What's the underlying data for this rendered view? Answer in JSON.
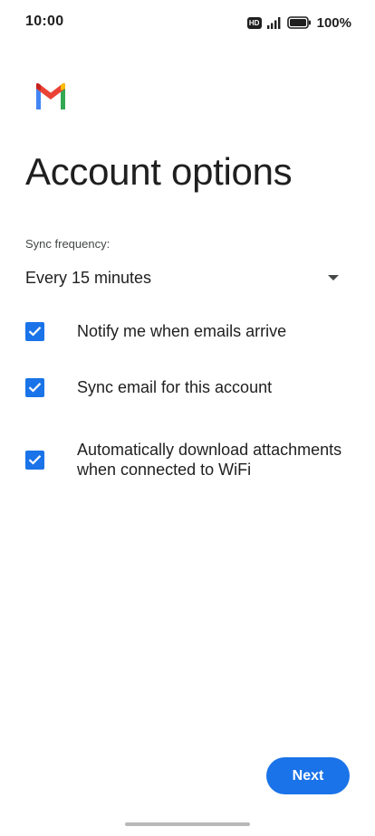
{
  "status_bar": {
    "time": "10:00",
    "hd_badge": "HD",
    "battery_percent": "100%",
    "icons": [
      "hd-icon",
      "signal-icon",
      "battery-icon"
    ]
  },
  "app": {
    "logo_icon": "gmail-logo-icon"
  },
  "page": {
    "title": "Account options"
  },
  "sync": {
    "label": "Sync frequency:",
    "selected": "Every 15 minutes"
  },
  "options": [
    {
      "label": "Notify me when emails arrive",
      "checked": true
    },
    {
      "label": "Sync email for this account",
      "checked": true
    },
    {
      "label": "Automatically download attachments when connected to WiFi",
      "checked": true
    }
  ],
  "footer": {
    "next_label": "Next"
  },
  "colors": {
    "accent": "#1a73e8",
    "text": "#1f1f1f",
    "secondary_text": "#444746"
  }
}
